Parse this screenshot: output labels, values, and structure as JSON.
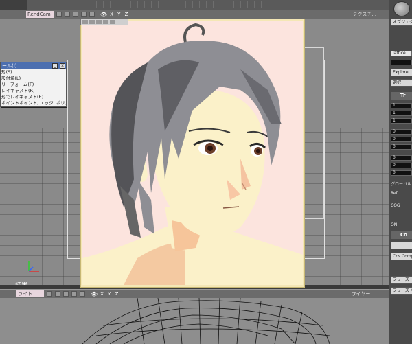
{
  "top_viewport": {
    "camera": "RendCam",
    "axes": "X Y Z",
    "right_label": "テクスチ...",
    "status": "結果"
  },
  "render_window": {},
  "popup_menu": {
    "title": "ール(I)",
    "items": [
      "形(S)",
      "設付焼(L)",
      "リーフォーム(F)",
      "レイキャスト(R)",
      "形でレイキャスト(E)",
      "ポイントポイント, エッジ, ポリゴン(G)"
    ]
  },
  "bottom_viewport": {
    "camera": "ライト",
    "axes": "X Y Z",
    "right_label": "ワイヤー..."
  },
  "right_panel": {
    "object_button": "オブジェクト",
    "lattice_field": "lattice",
    "explore_button": "Explore",
    "select_button": "選択",
    "transform_header": "Tr",
    "scale_values": [
      "1",
      "1",
      "1"
    ],
    "rotate_values": [
      "0",
      "0",
      "0"
    ],
    "translate_values": [
      "0",
      "0",
      "0"
    ],
    "global_label": "グローバル",
    "ref_label": "Ref",
    "cog_label": "COG",
    "on_label": "ON",
    "constraint_header": "Co",
    "freeze_button": "Cns Comp",
    "freeze1": "フリーズ",
    "freeze2": "フリーズ M"
  },
  "colors": {
    "render_bg": "#fce4de",
    "hair": "#8e8e94",
    "skin": "#fbf1c9",
    "popup_title": "#4c6fb0",
    "viewport_bg": "#8a8a8a"
  }
}
